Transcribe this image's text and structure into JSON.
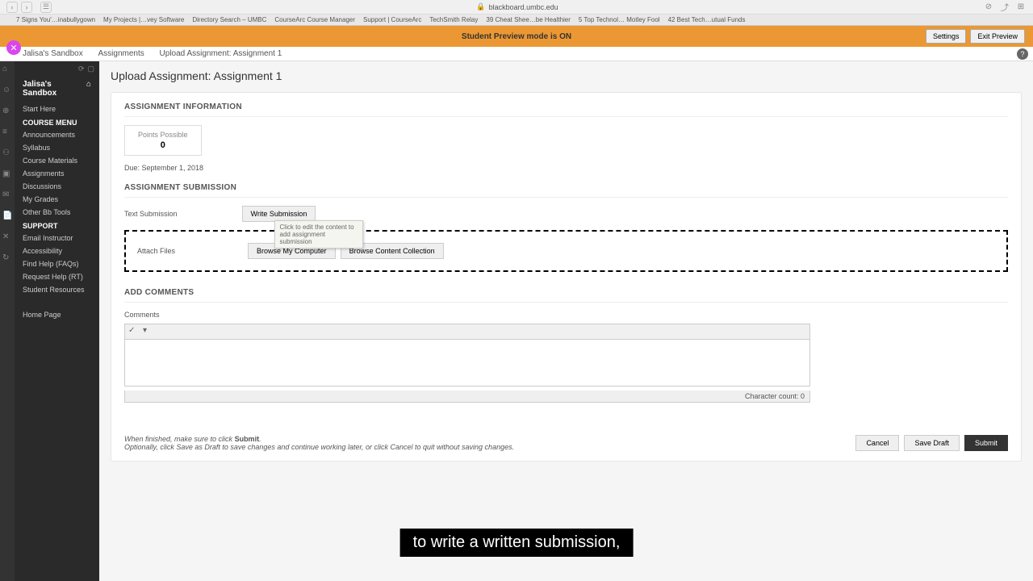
{
  "browser": {
    "url": "blackboard.umbc.edu",
    "bookmarks": [
      "7 Signs You'…inabullygown",
      "My Projects |…vey Software",
      "Directory Search – UMBC",
      "CourseArc Course Manager",
      "Support | CourseArc",
      "TechSmith Relay",
      "39 Cheat Shee…be Healthier",
      "5 Top Technol… Motley Fool",
      "42 Best Tech…utual Funds"
    ]
  },
  "preview": {
    "text": "Student Preview mode is ON",
    "settings_label": "Settings",
    "exit_label": "Exit Preview"
  },
  "breadcrumb": {
    "items": [
      "Jalisa's Sandbox",
      "Assignments",
      "Upload Assignment: Assignment 1"
    ]
  },
  "sidebar": {
    "course_title": "Jalisa's Sandbox",
    "start_here": "Start Here",
    "course_menu_header": "COURSE MENU",
    "course_menu": [
      "Announcements",
      "Syllabus",
      "Course Materials",
      "Assignments",
      "Discussions",
      "My Grades",
      "Other Bb Tools"
    ],
    "support_header": "SUPPORT",
    "support_menu": [
      "Email Instructor",
      "Accessibility",
      "Find Help (FAQs)",
      "Request Help (RT)",
      "Student Resources"
    ],
    "home_page": "Home Page"
  },
  "page": {
    "title": "Upload Assignment: Assignment 1",
    "sections": {
      "info_header": "ASSIGNMENT INFORMATION",
      "points_label": "Points Possible",
      "points_value": "0",
      "due_date": "Due: September 1, 2018",
      "submission_header": "ASSIGNMENT SUBMISSION",
      "text_submission_label": "Text Submission",
      "write_submission_button": "Write Submission",
      "tooltip_text": "Click to edit the content to add assignment submission",
      "attach_files_label": "Attach Files",
      "browse_computer": "Browse My Computer",
      "browse_content": "Browse Content Collection",
      "comments_header": "ADD COMMENTS",
      "comments_label": "Comments",
      "char_count": "Character count: 0"
    },
    "footer": {
      "line1_before": "When finished, make sure to click ",
      "line1_bold": "Submit",
      "line1_after": ".",
      "line2": "Optionally, click Save as Draft to save changes and continue working later, or click Cancel to quit without saving changes.",
      "cancel": "Cancel",
      "save_draft": "Save Draft",
      "submit": "Submit"
    }
  },
  "caption": "to write a written submission,"
}
